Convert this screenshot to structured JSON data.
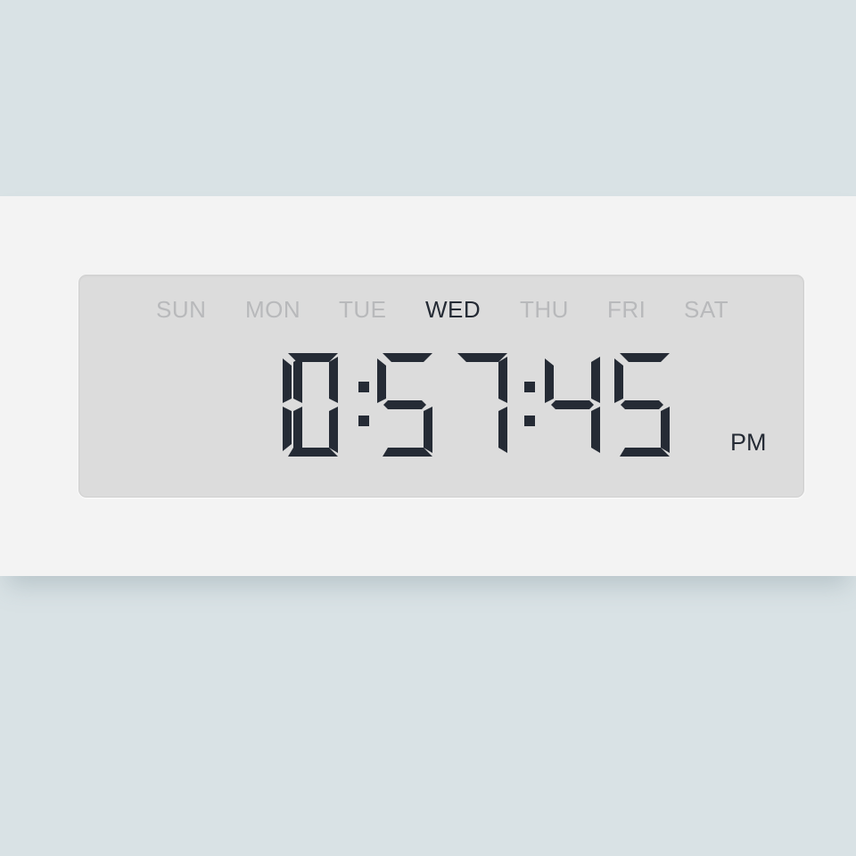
{
  "clock": {
    "days": [
      {
        "label": "SUN",
        "active": false
      },
      {
        "label": "MON",
        "active": false
      },
      {
        "label": "TUE",
        "active": false
      },
      {
        "label": "WED",
        "active": true
      },
      {
        "label": "THU",
        "active": false
      },
      {
        "label": "FRI",
        "active": false
      },
      {
        "label": "SAT",
        "active": false
      }
    ],
    "time": "10:57:45",
    "meridiem": "PM",
    "colors": {
      "background": "#d9e2e5",
      "band": "#f3f3f3",
      "lcd": "#dcdcdc",
      "lit": "#252b35",
      "dim": "#b8b9bb"
    }
  }
}
